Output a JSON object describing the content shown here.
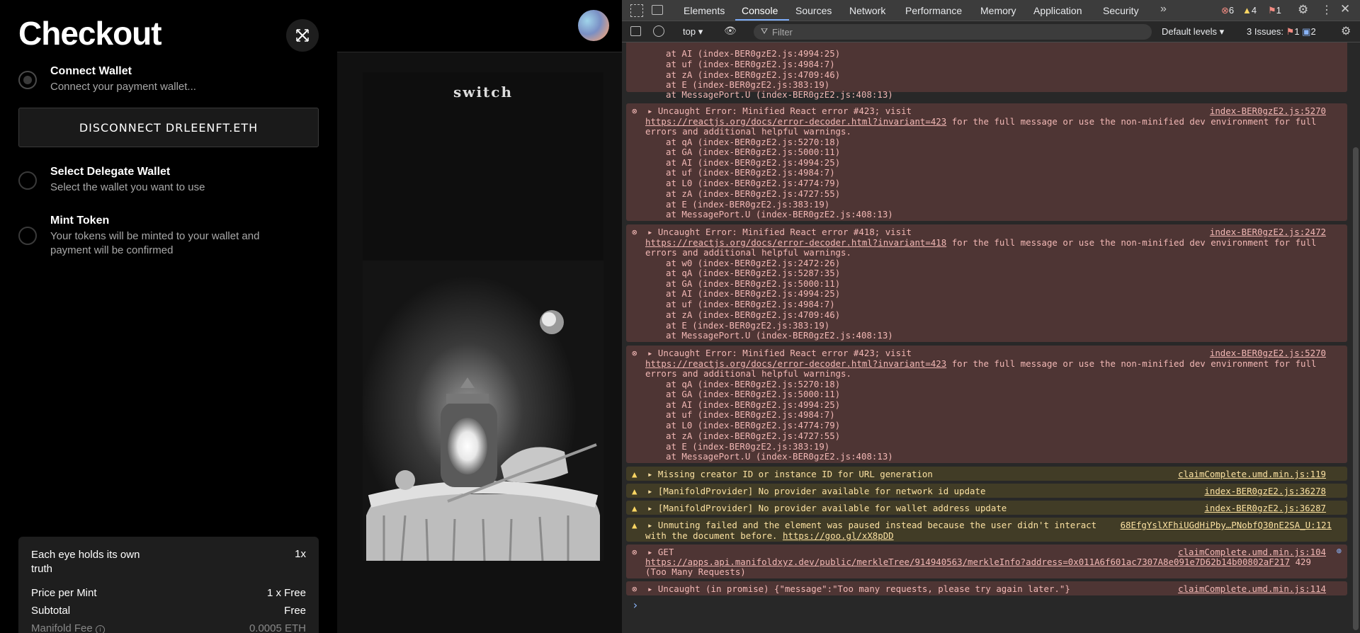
{
  "checkout": {
    "title": "Checkout",
    "steps": [
      {
        "title": "Connect Wallet",
        "desc": "Connect your payment wallet..."
      },
      {
        "title": "Select Delegate Wallet",
        "desc": "Select the wallet you want to use"
      },
      {
        "title": "Mint Token",
        "desc": "Your tokens will be minted to your wallet and payment will be confirmed"
      }
    ],
    "disconnect_label": "DISCONNECT DRLEENFT.ETH",
    "summary": [
      {
        "label": "Each eye holds its own truth",
        "value": "1x"
      },
      {
        "label": "Price per Mint",
        "value": "1 x Free"
      },
      {
        "label": "Subtotal",
        "value": "Free"
      },
      {
        "label": "Manifold Fee",
        "value": "0.0005 ETH"
      }
    ]
  },
  "preview": {
    "card_title": "switch"
  },
  "devtools": {
    "tabs": [
      "Elements",
      "Console",
      "Sources",
      "Network",
      "Performance",
      "Memory",
      "Application",
      "Security"
    ],
    "active_tab": "Console",
    "counts": {
      "errors": "6",
      "warnings": "4",
      "issues": "1"
    },
    "context": "top",
    "filter_placeholder": "Filter",
    "levels": "Default levels",
    "issues_label": "3 Issues:",
    "issues_errors": "1",
    "issues_info": "2",
    "colors": {
      "error_bg": "#4e3534",
      "warn_bg": "#413c26",
      "accent": "#7cacf8"
    }
  },
  "console": {
    "first": [
      "at AI (index-BER0gzE2.js:4994:25)",
      "at uf (index-BER0gzE2.js:4984:7)",
      "at zA (index-BER0gzE2.js:4709:46)",
      "at E (index-BER0gzE2.js:383:19)",
      "at MessagePort.U (index-BER0gzE2.js:408:13)"
    ],
    "e423a": {
      "head": "Uncaught Error: Minified React error #423; visit",
      "src": "index-BER0gzE2.js:5270",
      "url": "https://reactjs.org/docs/error-decoder.html?invariant=423",
      "tail": "for the full message or use the non-minified dev environment for full",
      "tail2": "errors and additional helpful warnings.",
      "stack": [
        "at qA (index-BER0gzE2.js:5270:18)",
        "at GA (index-BER0gzE2.js:5000:11)",
        "at AI (index-BER0gzE2.js:4994:25)",
        "at uf (index-BER0gzE2.js:4984:7)",
        "at L0 (index-BER0gzE2.js:4774:79)",
        "at zA (index-BER0gzE2.js:4727:55)",
        "at E (index-BER0gzE2.js:383:19)",
        "at MessagePort.U (index-BER0gzE2.js:408:13)"
      ]
    },
    "e418": {
      "head": "Uncaught Error: Minified React error #418; visit",
      "src": "index-BER0gzE2.js:2472",
      "url": "https://reactjs.org/docs/error-decoder.html?invariant=418",
      "tail": "for the full message or use the non-minified dev environment for full",
      "tail2": "errors and additional helpful warnings.",
      "stack": [
        "at w0 (index-BER0gzE2.js:2472:26)",
        "at qA (index-BER0gzE2.js:5287:35)",
        "at GA (index-BER0gzE2.js:5000:11)",
        "at AI (index-BER0gzE2.js:4994:25)",
        "at uf (index-BER0gzE2.js:4984:7)",
        "at zA (index-BER0gzE2.js:4709:46)",
        "at E (index-BER0gzE2.js:383:19)",
        "at MessagePort.U (index-BER0gzE2.js:408:13)"
      ]
    },
    "e423b": {
      "head": "Uncaught Error: Minified React error #423; visit",
      "src": "index-BER0gzE2.js:5270",
      "url": "https://reactjs.org/docs/error-decoder.html?invariant=423",
      "tail": "for the full message or use the non-minified dev environment for full",
      "tail2": "errors and additional helpful warnings.",
      "stack": [
        "at qA (index-BER0gzE2.js:5270:18)",
        "at GA (index-BER0gzE2.js:5000:11)",
        "at AI (index-BER0gzE2.js:4994:25)",
        "at uf (index-BER0gzE2.js:4984:7)",
        "at L0 (index-BER0gzE2.js:4774:79)",
        "at zA (index-BER0gzE2.js:4727:55)",
        "at E (index-BER0gzE2.js:383:19)",
        "at MessagePort.U (index-BER0gzE2.js:408:13)"
      ]
    },
    "warnings": [
      {
        "text": "Missing creator ID or instance ID for URL generation",
        "src": "claimComplete.umd.min.js:119"
      },
      {
        "text": "[ManifoldProvider] No provider available for network id update",
        "src": "index-BER0gzE2.js:36278"
      },
      {
        "text": "[ManifoldProvider] No provider available for wallet address update",
        "src": "index-BER0gzE2.js:36287"
      }
    ],
    "unmute": {
      "text": "Unmuting failed and the element was paused instead because the user didn't interact",
      "text2": "with the document before.",
      "link": "https://goo.gl/xX8pDD",
      "src": "68EfgYslXFhiUGdHiPby…PNobfQ30nE2SA_U:121"
    },
    "get": {
      "method": "GET",
      "src": "claimComplete.umd.min.js:104",
      "url": "https://apps.api.manifoldxyz.dev/public/merkleTree/914940563/merkleInfo?address=0x011A6f601ac7307A8e091e7D62b14b00802aF217",
      "status": "429",
      "status_text": "(Too Many Requests)"
    },
    "promise": {
      "text": "Uncaught (in promise) {\"message\":\"Too many requests, please try again later.\"}",
      "src": "claimComplete.umd.min.js:114"
    },
    "prompt": "›"
  }
}
